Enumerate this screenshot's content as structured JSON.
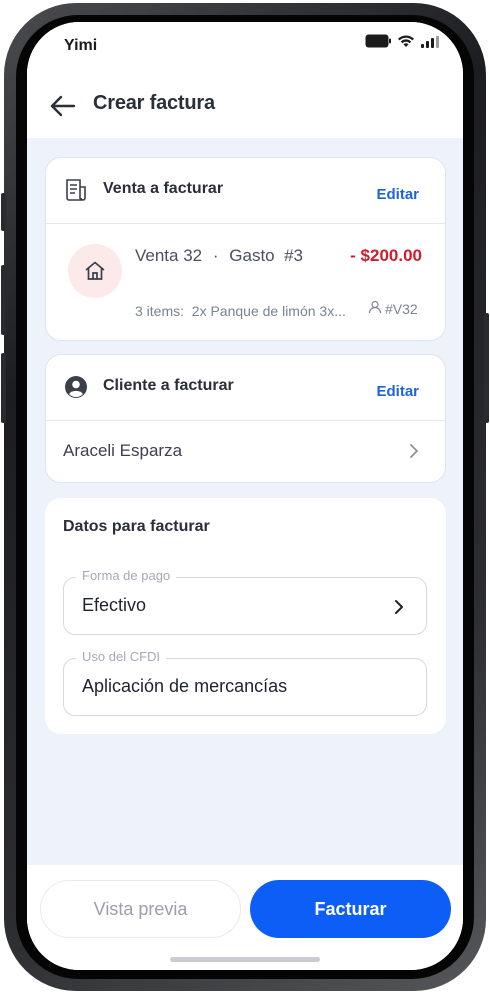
{
  "status_bar": {
    "carrier": "Yimi"
  },
  "header": {
    "title": "Crear factura"
  },
  "venta_card": {
    "title": "Venta a facturar",
    "edit_label": "Editar",
    "sale": {
      "name": "Venta 32",
      "separator": "·",
      "expense": "Gasto  #3",
      "amount": "- $200.00",
      "items_summary": "3 items:  2x Panque de limón 3x...",
      "reference": "#V32"
    }
  },
  "cliente_card": {
    "title": "Cliente a facturar",
    "edit_label": "Editar",
    "client_name": "Araceli Esparza"
  },
  "datos": {
    "title": "Datos para facturar",
    "forma_pago": {
      "label": "Forma de pago",
      "value": "Efectivo"
    },
    "uso_cfdi": {
      "label": "Uso del CFDI",
      "value": "Aplicación de mercancías"
    }
  },
  "actions": {
    "preview_label": "Vista previa",
    "submit_label": "Facturar"
  },
  "colors": {
    "accent": "#0d5ef6",
    "link": "#1f63d9",
    "negative_amount": "#d21c2a",
    "background": "#eef2fa"
  },
  "icons": [
    "back-arrow-icon",
    "receipt-icon",
    "house-icon",
    "user-icon",
    "user-circle-icon",
    "chevron-right-icon",
    "signal-icon",
    "wifi-icon",
    "battery-icon"
  ]
}
